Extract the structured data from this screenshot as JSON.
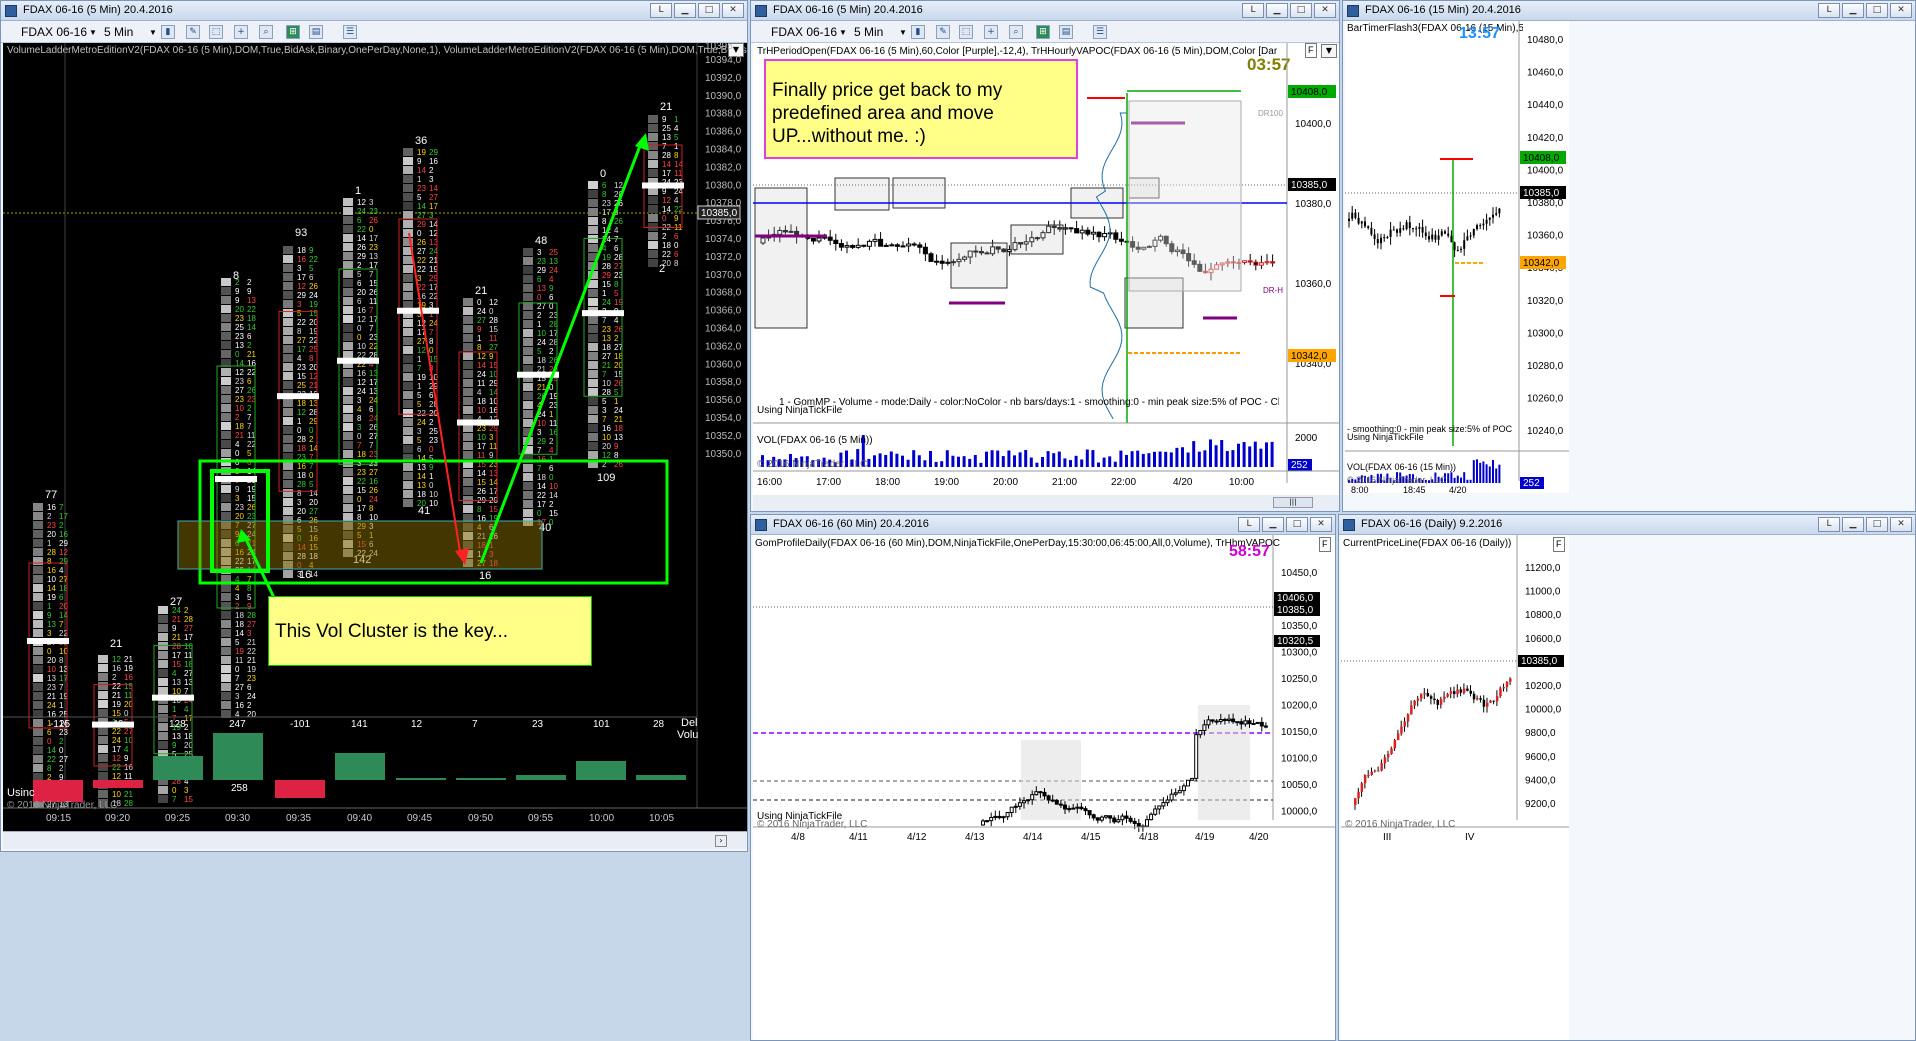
{
  "win1": {
    "title": "FDAX 06-16 (5 Min)  20.4.2016",
    "instrument": "FDAX 06-16",
    "interval": "5 Min",
    "indicator": "VolumeLadderMetroEditionV2(FDAX 06-16 (5 Min),DOM,True,BidAsk,Binary,OnePerDay,None,1), VolumeLadderMetroEditionV2(FDAX 06-16 (5 Min),DOM,True,BidAsk,Bi",
    "yaxis": [
      "10394,0",
      "10392,0",
      "10390,0",
      "10388,0",
      "10386,0",
      "10384,0",
      "10382,0",
      "10380,0",
      "10378,0",
      "10376,0",
      "10374,0",
      "10372,0",
      "10370,0",
      "10368,0",
      "10366,0",
      "10364,0",
      "10362,0",
      "10360,0",
      "10358,0",
      "10356,0",
      "10354,0",
      "10352,0",
      "10350,0"
    ],
    "top_tick": "10395",
    "current_price": "10385,0",
    "xaxis": [
      "09:15",
      "09:20",
      "09:25",
      "09:30",
      "09:35",
      "09:40",
      "09:45",
      "09:50",
      "09:55",
      "10:00",
      "10:05"
    ],
    "bar_tops": [
      "77",
      "21",
      "27",
      "8",
      "93",
      "1",
      "36",
      "21",
      "48",
      "0",
      "21"
    ],
    "bar_bottoms": [
      "16",
      "142",
      "41",
      "16",
      "40",
      "109",
      "2"
    ],
    "delta_values": [
      "-125",
      "-40",
      "128",
      "247",
      "-101",
      "141",
      "12",
      "7",
      "23",
      "101",
      "28"
    ],
    "delta_label": "Del",
    "vol_label": "Volu",
    "vol_258": "258",
    "using": "Usinc",
    "copyright": "© 2016 NinjaTrader, LLC",
    "note": "This Vol Cluster is the key..."
  },
  "win2": {
    "title": "FDAX 06-16 (5 Min)  20.4.2016",
    "instrument": "FDAX 06-16",
    "interval": "5 Min",
    "indicator": "TrHPeriodOpen(FDAX 06-16 (5 Min),60,Color [Purple],-12,4), TrHHourlyVAPOC(FDAX 06-16 (5 Min),DOM,Color [DarkGray],Color",
    "timer": "03:57",
    "note": "Finally price get back to my predefined area and move UP...without me. :)",
    "yaxis": [
      "10400,0",
      "10380,0",
      "10360,0",
      "10340,0"
    ],
    "tag_10408": "10408,0",
    "tag_10385": "10385,0",
    "tag_10342": "10342,0",
    "gom_label": "1 - GomMP - Volume - mode:Daily - color:NoColor - nb bars/days:1 - smoothing:0 - min peak size:5% of POC - Click to Delete",
    "using": "Using NinjaTickFile",
    "vol_label": "VOL(FDAX 06-16 (5 Min))",
    "vol_axis": "2000",
    "vol_tag": "252",
    "copyright": "© 2016 NinjaTrader, LLC",
    "xaxis": [
      "16:00",
      "17:00",
      "18:00",
      "19:00",
      "20:00",
      "21:00",
      "22:00",
      "4/20",
      "10:00"
    ],
    "dr_labels": [
      "DR100",
      "DR-H"
    ]
  },
  "win3": {
    "title": "FDAX 06-16 (15 Min)  20.4.2016",
    "indicator": "BarTimerFlash3(FDAX 06-16 (15 Min),5,T",
    "timer": "13:57",
    "yaxis": [
      "10480,0",
      "10460,0",
      "10440,0",
      "10420,0",
      "10400,0",
      "10380,0",
      "10360,0",
      "10340,0",
      "10320,0",
      "10300,0",
      "10280,0",
      "10260,0",
      "10240,0"
    ],
    "tag_10408": "10408,0",
    "tag_10385": "10385,0",
    "tag_10342": "10342,0",
    "smoothing": "- smoothing:0 - min peak size:5% of POC",
    "using": "Using NinjaTickFile",
    "vol_label": "VOL(FDAX 06-16 (15 Min))",
    "vol_tag": "252",
    "copyright": "© 2016 NinjaTrader, LLC",
    "xaxis": [
      "8:00",
      "18:45",
      "4/20"
    ]
  },
  "win4": {
    "title": "FDAX 06-16 (60 Min)  20.4.2016",
    "indicator": "GomProfileDaily(FDAX 06-16 (60 Min),DOM,NinjaTickFile,OnePerDay,15:30:00,06:45:00,All,0,Volume), TrHhmVAPOCd(FDAX 06",
    "timer": "58:57",
    "yaxis": [
      "10450,0",
      "10400,0",
      "10350,0",
      "10300,0",
      "10250,0",
      "10200,0",
      "10150,0",
      "10100,0",
      "10050,0",
      "10000,0"
    ],
    "tag_10406": "10406,0",
    "tag_10385": "10385,0",
    "tag_10320": "10320,5",
    "using": "Using NinjaTickFile",
    "copyright": "© 2016 NinjaTrader, LLC",
    "xaxis": [
      "4/8",
      "4/11",
      "4/12",
      "4/13",
      "4/14",
      "4/15",
      "4/18",
      "4/19",
      "4/20"
    ]
  },
  "win5": {
    "title": "FDAX 06-16 (Daily)  9.2.2016",
    "indicator": "CurrentPriceLine(FDAX 06-16 (Daily))",
    "yaxis": [
      "11200,0",
      "11000,0",
      "10800,0",
      "10600,0",
      "10400,0",
      "10200,0",
      "10000,0",
      "9800,0",
      "9600,0",
      "9400,0",
      "9200,0"
    ],
    "tag_10385": "10385,0",
    "copyright": "© 2016 NinjaTrader, LLC",
    "xaxis": [
      "III",
      "IV"
    ]
  },
  "colors": {
    "green": "#00ff00",
    "red": "#ff0000",
    "yellow_note": "#ffff88",
    "purple": "#800080",
    "timer_olive": "#808000",
    "timer_blue": "#1e90ff",
    "timer_magenta": "#d000d0"
  }
}
